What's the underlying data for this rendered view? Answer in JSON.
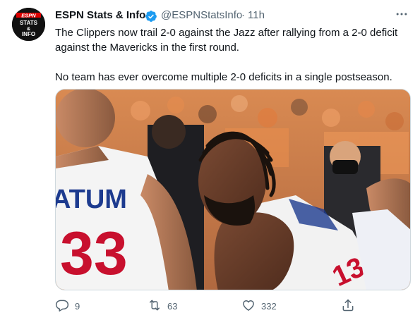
{
  "tweet": {
    "avatar_icon": "espn-stats-info-logo",
    "avatar_text": [
      "ESPN",
      "STATS",
      "&",
      "INFO"
    ],
    "display_name": "ESPN Stats & Info",
    "verified_icon": "verified-badge-icon",
    "handle": "@ESPNStatsInfo",
    "separator": "·",
    "time": "11h",
    "more_icon": "more-horizontal-icon",
    "text_lines": [
      "The Clippers now trail 2-0 against the Jazz after rallying from a 2-0 deficit",
      "against the Mavericks in the first round.",
      "No team has ever overcome multiple 2-0 deficits in a single postseason."
    ],
    "media": {
      "jersey_name": "ATUM",
      "jersey_number": "33"
    },
    "actions": {
      "reply": {
        "icon": "reply-icon",
        "count": "9"
      },
      "retweet": {
        "icon": "retweet-icon",
        "count": "63"
      },
      "like": {
        "icon": "heart-icon",
        "count": "332"
      },
      "share": {
        "icon": "share-icon"
      }
    }
  },
  "colors": {
    "text": "#0f1419",
    "secondary": "#536471",
    "verified": "#1d9bf0",
    "border": "#cfd9de"
  }
}
